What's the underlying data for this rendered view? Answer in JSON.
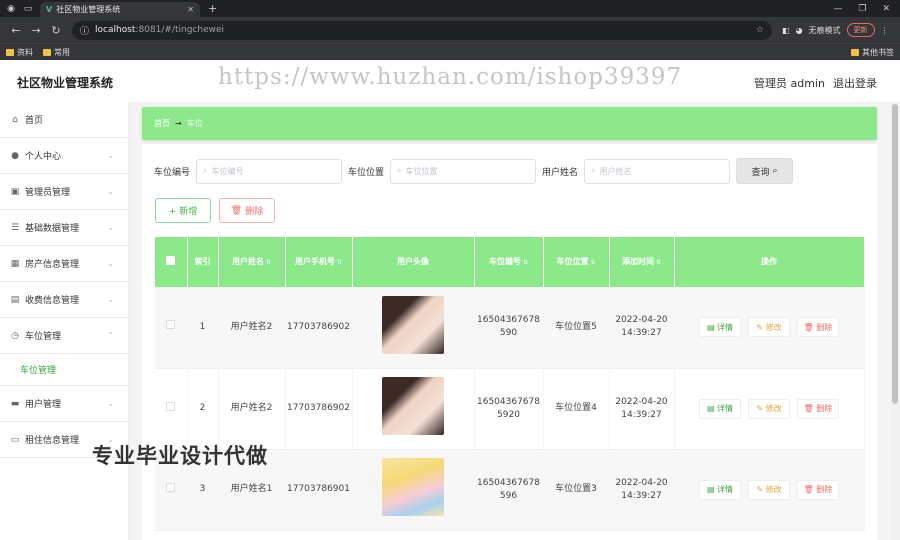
{
  "browser": {
    "tab_title": "社区物业管理系统",
    "url_host": "localhost",
    "url_rest": ":8081/#/tingchewei",
    "profile_label": "无痕模式",
    "update_label": "更新",
    "bookmarks": [
      "资料",
      "常用"
    ],
    "other_bookmarks": "其他书签"
  },
  "header": {
    "app_title": "社区物业管理系统",
    "watermark": "https://www.huzhan.com/ishop39397",
    "user": "管理员 admin",
    "logout": "退出登录"
  },
  "sidebar": {
    "items": [
      {
        "label": "首页",
        "icon": "home-icon"
      },
      {
        "label": "个人中心",
        "icon": "user-icon"
      },
      {
        "label": "管理员管理",
        "icon": "admin-icon"
      },
      {
        "label": "基础数据管理",
        "icon": "list-icon"
      },
      {
        "label": "房产信息管理",
        "icon": "grid-icon"
      },
      {
        "label": "收费信息管理",
        "icon": "doc-icon"
      },
      {
        "label": "车位管理",
        "icon": "clock-icon"
      },
      {
        "label": "用户管理",
        "icon": "flag-icon"
      },
      {
        "label": "租住信息管理",
        "icon": "monitor-icon"
      }
    ],
    "active_sub": "车位管理"
  },
  "promo_text": "专业毕业设计代做",
  "breadcrumb": {
    "home": "首页",
    "current": "车位"
  },
  "search": {
    "fields": [
      {
        "label": "车位编号",
        "placeholder": "车位编号"
      },
      {
        "label": "车位位置",
        "placeholder": "车位位置"
      },
      {
        "label": "用户姓名",
        "placeholder": "用户姓名"
      }
    ],
    "query_label": "查询"
  },
  "actions": {
    "add": "+ 新增",
    "delete": "删除"
  },
  "table": {
    "headers": [
      "索引",
      "用户姓名",
      "用户手机号",
      "用户头像",
      "车位编号",
      "车位位置",
      "添加时间",
      "操作"
    ],
    "rows": [
      {
        "index": "1",
        "name": "用户姓名2",
        "phone": "17703786902",
        "code": "16504367678590",
        "position": "车位位置5",
        "time": "2022-04-20 14:39:27"
      },
      {
        "index": "2",
        "name": "用户姓名2",
        "phone": "17703786902",
        "code": "165043676785920",
        "position": "车位位置4",
        "time": "2022-04-20 14:39:27"
      },
      {
        "index": "3",
        "name": "用户姓名1",
        "phone": "17703786901",
        "code": "16504367678596",
        "position": "车位位置3",
        "time": "2022-04-20 14:39:27"
      }
    ],
    "op_labels": {
      "detail": "详情",
      "edit": "修改",
      "remove": "删除"
    }
  }
}
